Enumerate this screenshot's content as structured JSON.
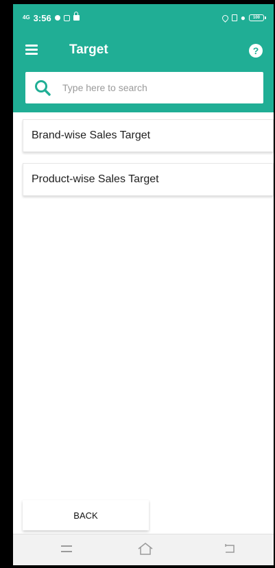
{
  "status_bar": {
    "network": "4G",
    "time": "3:56",
    "battery": "100"
  },
  "app_bar": {
    "title": "Target",
    "menu_icon": "hamburger-menu-icon",
    "help_icon": "help-question-icon",
    "help_glyph": "?"
  },
  "search": {
    "placeholder": "Type here to search",
    "value": "",
    "icon": "search-icon"
  },
  "list": {
    "items": [
      {
        "label": "Brand-wise Sales Target"
      },
      {
        "label": "Product-wise Sales Target"
      }
    ]
  },
  "footer": {
    "back_label": "BACK"
  },
  "colors": {
    "primary": "#20ae95",
    "background": "#ffffff",
    "text": "#1e1e1e",
    "placeholder": "#9a9a9a"
  }
}
